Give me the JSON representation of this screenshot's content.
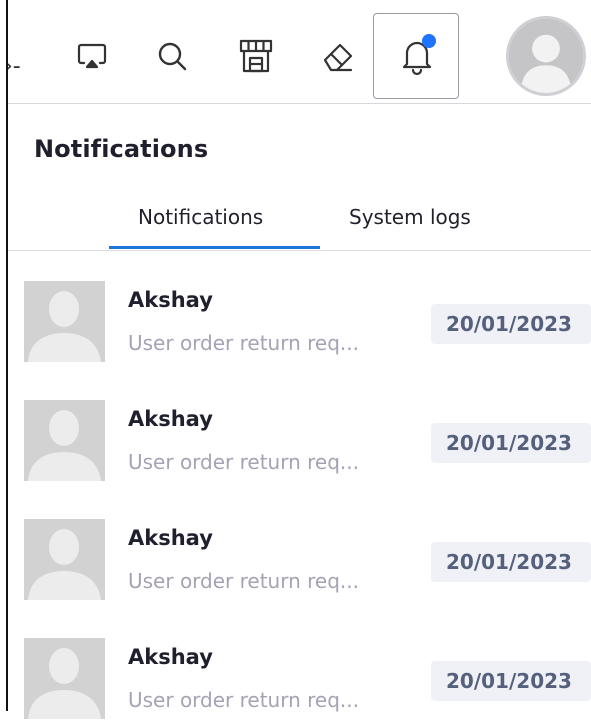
{
  "topbar": {
    "edge_glyph": "›-",
    "icons": [
      "cast-icon",
      "search-icon",
      "store-icon",
      "eraser-icon",
      "bell-icon"
    ],
    "notification_dot_color": "#1e74ff"
  },
  "panel": {
    "title": "Notifications",
    "tabs": [
      {
        "label": "Notifications",
        "active": true
      },
      {
        "label": "System logs",
        "active": false
      }
    ],
    "accent_color": "#1e74d8"
  },
  "notifications": [
    {
      "name": "Akshay",
      "message": "User order return req...",
      "date": "20/01/2023"
    },
    {
      "name": "Akshay",
      "message": "User order return req...",
      "date": "20/01/2023"
    },
    {
      "name": "Akshay",
      "message": "User order return req...",
      "date": "20/01/2023"
    },
    {
      "name": "Akshay",
      "message": "User order return req...",
      "date": "20/01/2023"
    }
  ]
}
